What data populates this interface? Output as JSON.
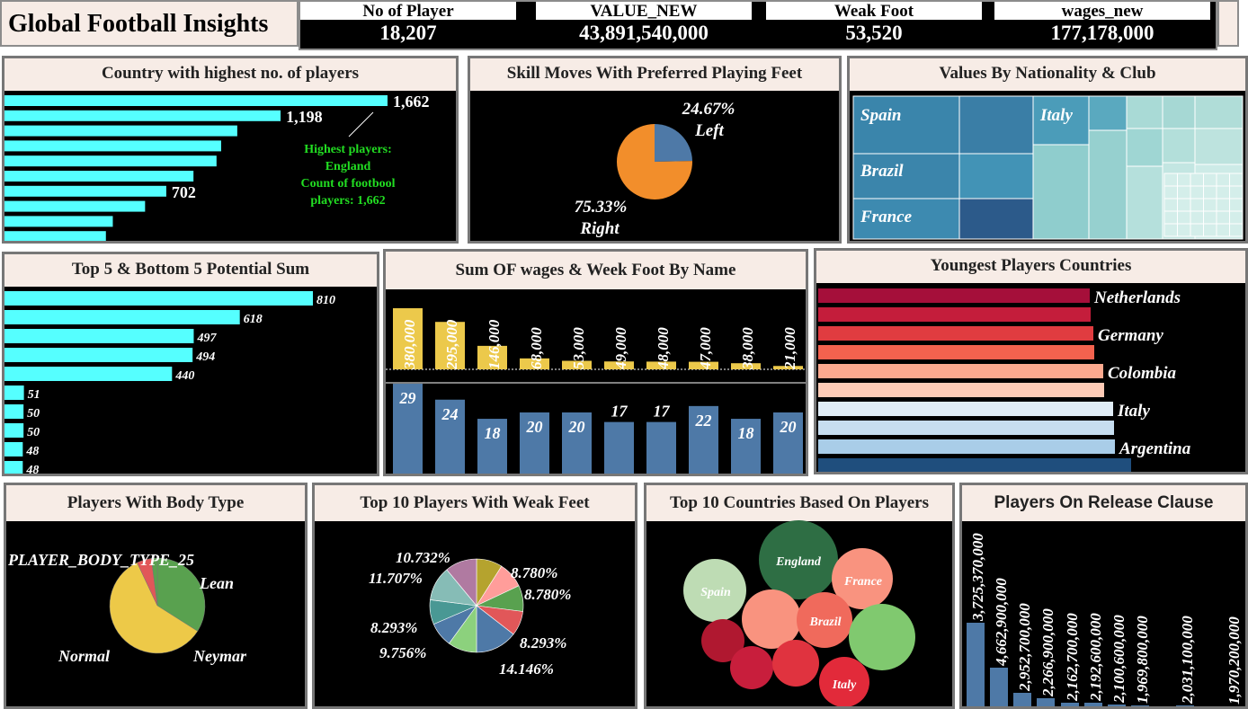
{
  "header": {
    "title": "Global Football Insights"
  },
  "kpis": [
    {
      "label": "No of Player",
      "value": "18,207"
    },
    {
      "label": "VALUE_NEW",
      "value": "43,891,540,000"
    },
    {
      "label": "Weak Foot",
      "value": "53,520"
    },
    {
      "label": "wages_new",
      "value": "177,178,000"
    }
  ],
  "colors": {
    "cyan": "#55ffff",
    "gold": "#ecc94b",
    "blue": "#4e79a7",
    "orange": "#f28e2b",
    "annot_green": "#22dd22"
  },
  "chart_data": [
    {
      "type": "bar",
      "id": "country_players",
      "title": "Country with highest no. of players",
      "values": [
        1662,
        1198,
        1010,
        940,
        920,
        820,
        702,
        610,
        470,
        440
      ],
      "data_labels": {
        "0": "1,662",
        "1": "1,198",
        "6": "702"
      },
      "annotation": [
        "Highest players:",
        "England",
        "Count of footbool",
        "players: 1,662"
      ]
    },
    {
      "type": "pie",
      "id": "preferred_foot",
      "title": "Skill Moves With Preferred Playing Feet",
      "slices": [
        {
          "name": "Left",
          "value": 24.67,
          "label": "24.67%"
        },
        {
          "name": "Right",
          "value": 75.33,
          "label": "75.33%"
        }
      ]
    },
    {
      "type": "treemap",
      "id": "nationality_club",
      "title": "Values By Nationality & Club",
      "labels": [
        "Spain",
        "Brazil",
        "France",
        "Italy"
      ]
    },
    {
      "type": "bar",
      "id": "potential_sum",
      "title": "Top 5 & Bottom 5 Potential Sum",
      "values": [
        810,
        618,
        497,
        494,
        440,
        51,
        50,
        50,
        48,
        48
      ],
      "labels": [
        "810",
        "618",
        "497",
        "494",
        "440",
        "51",
        "50",
        "50",
        "48",
        "48"
      ]
    },
    {
      "type": "bar",
      "id": "wages_weakfoot",
      "title": "Sum OF wages & Week Foot By Name",
      "wages": [
        380000,
        295000,
        146000,
        68000,
        53000,
        49000,
        48000,
        47000,
        38000,
        21000
      ],
      "wage_labels": [
        "380,000",
        "295,000",
        "146,000",
        "68,000",
        "53,000",
        "49,000",
        "48,000",
        "47,000",
        "38,000",
        "21,000"
      ],
      "weak_foot": [
        29,
        24,
        18,
        20,
        20,
        17,
        17,
        22,
        18,
        20
      ]
    },
    {
      "type": "bar",
      "id": "youngest_countries",
      "title": "Youngest Players Countries",
      "values": [
        302,
        303,
        306,
        307,
        317,
        318,
        328,
        329,
        330,
        348
      ],
      "labels": {
        "0": "Netherlands",
        "2": "Germany",
        "4": "Colombia",
        "6": "Italy",
        "8": "Argentina"
      },
      "bar_colors": [
        "#a50f3a",
        "#c41d3b",
        "#e03c40",
        "#f4624e",
        "#fca98f",
        "#fdcbb6",
        "#e0edf6",
        "#c7def0",
        "#a9cde8",
        "#1f4e7d"
      ]
    },
    {
      "type": "pie",
      "id": "body_type",
      "title": "Players With Body Type",
      "slices": [
        {
          "name": "Lean",
          "value": 34
        },
        {
          "name": "Normal",
          "value": 59
        },
        {
          "name": "PLAYER_BODY_TYPE_25",
          "value": 5
        },
        {
          "name": "Neymar",
          "value": 2
        }
      ],
      "labels": [
        "PLAYER_BODY_TYPE_25",
        "Lean",
        "Normal",
        "Neymar"
      ]
    },
    {
      "type": "pie",
      "id": "weak_feet_top10",
      "title": "Top 10 Players With Weak Feet",
      "slices": [
        {
          "value": 8.78,
          "color": "#b5a32e"
        },
        {
          "value": 8.78,
          "color": "#ff9d9a"
        },
        {
          "value": 8.78,
          "color": "#59a14f"
        },
        {
          "value": 8.293,
          "color": "#e15759"
        },
        {
          "value": 14.146,
          "color": "#4e79a7"
        },
        {
          "value": 9.756,
          "color": "#8cd17d"
        },
        {
          "value": 8.293,
          "color": "#4e79a7"
        },
        {
          "value": 8.293,
          "color": "#499894"
        },
        {
          "value": 11.707,
          "color": "#86bcb6"
        },
        {
          "value": 10.732,
          "color": "#b07aa1"
        }
      ],
      "labels": [
        "10.732%",
        "11.707%",
        "8.780%",
        "8.780%",
        "8.293%",
        "9.756%",
        "8.293%",
        "14.146%"
      ]
    },
    {
      "type": "bubble",
      "id": "top10_countries",
      "title": "Top 10 Countries Based On Players",
      "labels": [
        "England",
        "France",
        "Spain",
        "Brazil",
        "Italy"
      ]
    },
    {
      "type": "bar",
      "id": "release_clause",
      "title": "Players On Release Clause",
      "values": [
        3725370000,
        4662900000,
        2952700000,
        2266900000,
        2162700000,
        2192600000,
        2100600000,
        1969800000,
        2031100000,
        1970200000
      ],
      "labels": [
        "3,725,370,000",
        "4,662,900,000",
        "2,952,700,000",
        "2,266,900,000",
        "2,162,700,000",
        "2,192,600,000",
        "2,100,600,000",
        "1,969,800,000",
        "2,031,100,000",
        "1,970,200,000"
      ]
    }
  ]
}
